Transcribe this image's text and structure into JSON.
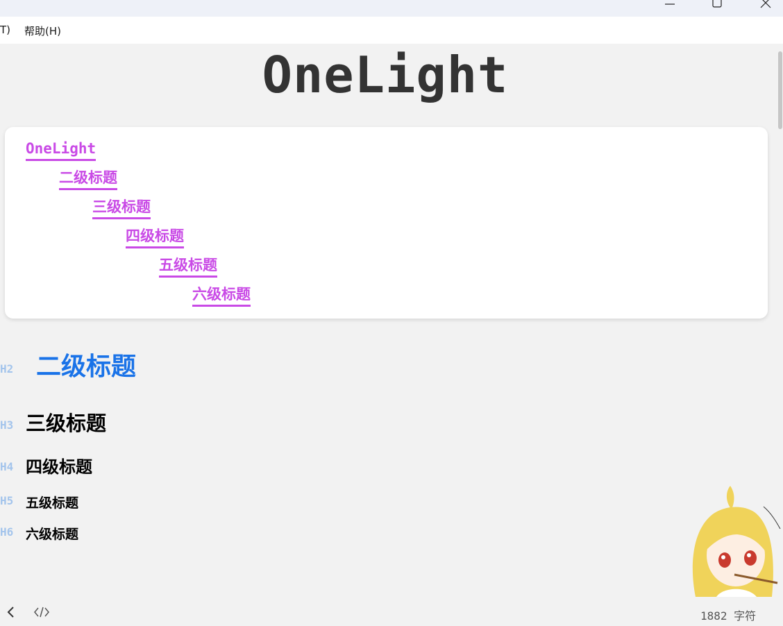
{
  "menubar": {
    "tools_fragment": "T)",
    "help": "帮助(H)"
  },
  "document": {
    "title": "OneLight"
  },
  "toc": {
    "items": [
      {
        "label": "OneLight",
        "level": 1
      },
      {
        "label": "二级标题",
        "level": 2
      },
      {
        "label": "三级标题",
        "level": 3
      },
      {
        "label": "四级标题",
        "level": 4
      },
      {
        "label": "五级标题",
        "level": 5
      },
      {
        "label": "六级标题",
        "level": 6
      }
    ]
  },
  "headings": [
    {
      "tag": "H2",
      "text": "二级标题"
    },
    {
      "tag": "H3",
      "text": "三级标题"
    },
    {
      "tag": "H4",
      "text": "四级标题"
    },
    {
      "tag": "H5",
      "text": "五级标题"
    },
    {
      "tag": "H6",
      "text": "六级标题"
    }
  ],
  "statusbar": {
    "word_count": "1882 字符"
  },
  "icons": {
    "minimize": "minimize-icon",
    "maximize": "maximize-icon",
    "close": "close-icon",
    "back": "chevron-left-icon",
    "source": "code-icon"
  },
  "colors": {
    "toc_link": "#c94ae6",
    "h2": "#1a73e8",
    "heading_tag": "#a3c4ec",
    "background": "#f2f2f2"
  }
}
